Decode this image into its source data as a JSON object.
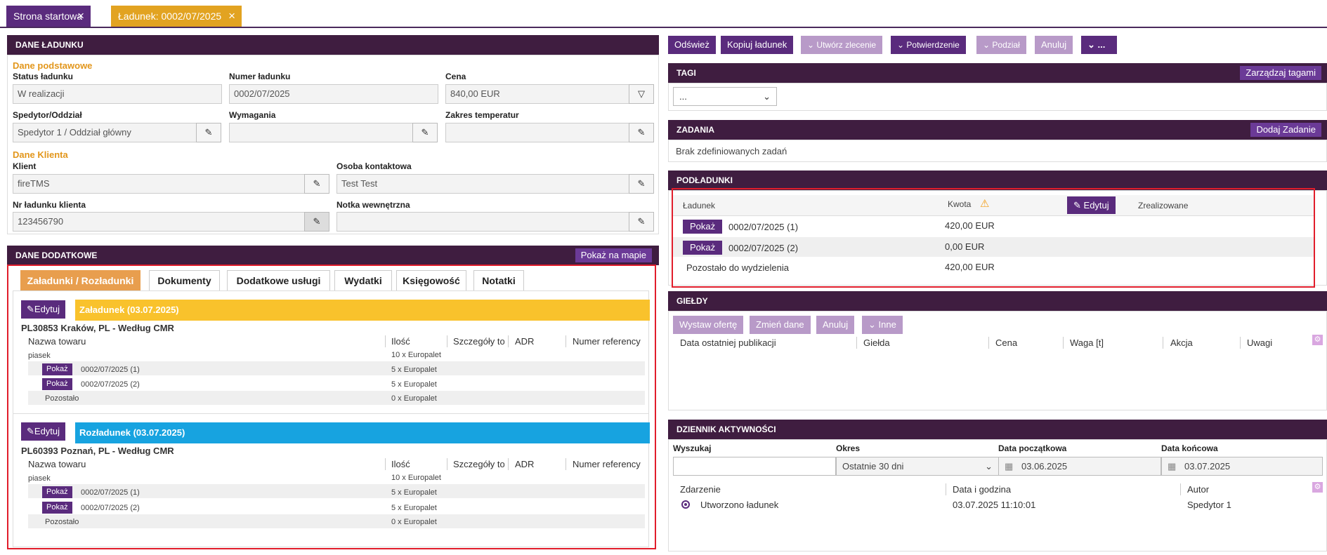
{
  "tabs": [
    {
      "label": "Strona startowa"
    },
    {
      "label": "Ładunek: 0002/07/2025"
    }
  ],
  "dane": {
    "title": "DANE ŁADUNKU",
    "podstawowe": "Dane podstawowe",
    "status_label": "Status ładunku",
    "status": "W realizacji",
    "numer_label": "Numer ładunku",
    "numer": "0002/07/2025",
    "cena_label": "Cena",
    "cena": "840,00 EUR",
    "spedytor_label": "Spedytor/Oddział",
    "spedytor": "Spedytor 1 / Oddział główny",
    "wymagania_label": "Wymagania",
    "wymagania": "",
    "zakres_label": "Zakres temperatur",
    "zakres": "",
    "klienta": "Dane Klienta",
    "klient_label": "Klient",
    "klient": "fireTMS",
    "osoba_label": "Osoba kontaktowa",
    "osoba": "Test Test",
    "nrklienta_label": "Nr ładunku klienta",
    "nrklienta": "123456790",
    "notka_label": "Notka wewnętrzna",
    "notka": ""
  },
  "dodatkowe": {
    "title": "DANE DODATKOWE",
    "mapa": "Pokaż na mapie",
    "tabs": [
      "Załadunki / Rozładunki",
      "Dokumenty",
      "Dodatkowe usługi",
      "Wydatki",
      "Księgowość",
      "Notatki"
    ],
    "edit": "Edytuj",
    "cols": [
      "Nazwa towaru",
      "Ilość",
      "Szczegóły tov",
      "ADR",
      "Numer referency"
    ],
    "stops": [
      {
        "title": "Załadunek (03.07.2025)",
        "color": "#f9c22c",
        "address": "PL30853 Kraków, PL - Według CMR",
        "towar": "piasek",
        "ilosc": "10 x Europalet",
        "rows": [
          {
            "btn": "Pokaż",
            "nr": "0002/07/2025 (1)",
            "ilosc": "5 x Europalet"
          },
          {
            "btn": "Pokaż",
            "nr": "0002/07/2025 (2)",
            "ilosc": "5 x Europalet"
          }
        ],
        "rest": "Pozostało",
        "rest_ilosc": "0 x Europalet"
      },
      {
        "title": "Rozładunek (03.07.2025)",
        "color": "#17a3e0",
        "address": "PL60393 Poznań, PL - Według CMR",
        "towar": "piasek",
        "ilosc": "10 x Europalet",
        "rows": [
          {
            "btn": "Pokaż",
            "nr": "0002/07/2025 (1)",
            "ilosc": "5 x Europalet"
          },
          {
            "btn": "Pokaż",
            "nr": "0002/07/2025 (2)",
            "ilosc": "5 x Europalet"
          }
        ],
        "rest": "Pozostało",
        "rest_ilosc": "0 x Europalet"
      }
    ]
  },
  "toolbar": {
    "odswiez": "Odśwież",
    "kopiuj": "Kopiuj ładunek",
    "utworz": "Utwórz zlecenie",
    "potwierdzenie": "Potwierdzenie",
    "podzial": "Podział",
    "anuluj": "Anuluj",
    "more": "..."
  },
  "tagi": {
    "title": "TAGI",
    "btn": "Zarządzaj tagami",
    "select": "..."
  },
  "zadania": {
    "title": "ZADANIA",
    "btn": "Dodaj Zadanie",
    "empty": "Brak zdefiniowanych zadań"
  },
  "podladunki": {
    "title": "PODŁADUNKI",
    "col_ladunek": "Ładunek",
    "col_kwota": "Kwota",
    "edit": "Edytuj",
    "col_zrealizowane": "Zrealizowane",
    "rows": [
      {
        "btn": "Pokaż",
        "nr": "0002/07/2025 (1)",
        "kwota": "420,00 EUR"
      },
      {
        "btn": "Pokaż",
        "nr": "0002/07/2025 (2)",
        "kwota": "0,00 EUR"
      }
    ],
    "rest": "Pozostało do wydzielenia",
    "rest_kwota": "420,00 EUR"
  },
  "gieldy": {
    "title": "GIEŁDY",
    "btns": [
      "Wystaw ofertę",
      "Zmień dane",
      "Anuluj",
      "Inne"
    ],
    "cols": [
      "Data ostatniej publikacji",
      "Giełda",
      "Cena",
      "Waga [t]",
      "Akcja",
      "Uwagi"
    ]
  },
  "dziennik": {
    "title": "DZIENNIK AKTYWNOŚCI",
    "wyszukaj": "Wyszukaj",
    "okres": "Okres",
    "okres_val": "Ostatnie 30 dni",
    "od_label": "Data początkowa",
    "od": "03.06.2025",
    "do_label": "Data końcowa",
    "do": "03.07.2025",
    "cols": [
      "Zdarzenie",
      "Data i godzina",
      "Autor"
    ],
    "row": {
      "event": "Utworzono ładunek",
      "date": "03.07.2025 11:10:01",
      "author": "Spedytor 1"
    }
  },
  "colors": {
    "header": "#3f1d40",
    "accent": "#5a2b7d",
    "orange": "#e2961b",
    "highlight": "#e11d2b"
  }
}
